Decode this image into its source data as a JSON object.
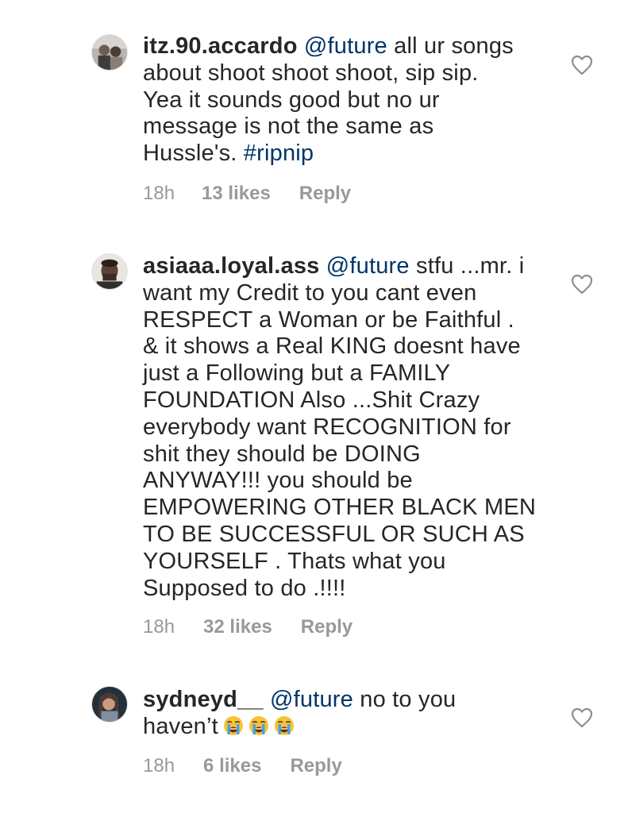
{
  "comments": [
    {
      "username": "itz.90.accardo",
      "mention": "@future",
      "text_after_mention": " all ur songs\nabout shoot shoot shoot, sip sip.\nYea it sounds good but no ur\nmessage is not the same as\nHussle's.  ",
      "hashtag": "#ripnip",
      "time": "18h",
      "likes": "13 likes",
      "reply": "Reply",
      "avatar_icon": "avatar-photo-icon",
      "like_icon": "heart-outline-icon"
    },
    {
      "username": "asiaaa.loyal.ass",
      "mention": "@future",
      "text_after_mention": " stfu ...mr. i\nwant my Credit to you cant even\nRESPECT a Woman or be Faithful .\n& it shows a Real KING doesnt have\njust a Following but a FAMILY\nFOUNDATION Also ...Shit Crazy\neverybody want RECOGNITION for\nshit they should be DOING\nANYWAY!!! you should be\nEMPOWERING OTHER BLACK MEN\nTO BE SUCCESSFUL OR SUCH AS\nYOURSELF . Thats what you\nSupposed to do .!!!!",
      "time": "18h",
      "likes": "32 likes",
      "reply": "Reply",
      "avatar_icon": "avatar-photo-icon",
      "like_icon": "heart-outline-icon"
    },
    {
      "username": "sydneyd__",
      "mention": "@future",
      "text_after_mention": " no to you\nhaven’t",
      "emoji": [
        "loudly-crying-face-emoji",
        "loudly-crying-face-emoji",
        "loudly-crying-face-emoji"
      ],
      "time": "18h",
      "likes": "6 likes",
      "reply": "Reply",
      "avatar_icon": "avatar-photo-icon",
      "like_icon": "heart-outline-icon"
    }
  ],
  "colors": {
    "text": "#262626",
    "link": "#003569",
    "meta": "#999999",
    "background": "#ffffff"
  }
}
